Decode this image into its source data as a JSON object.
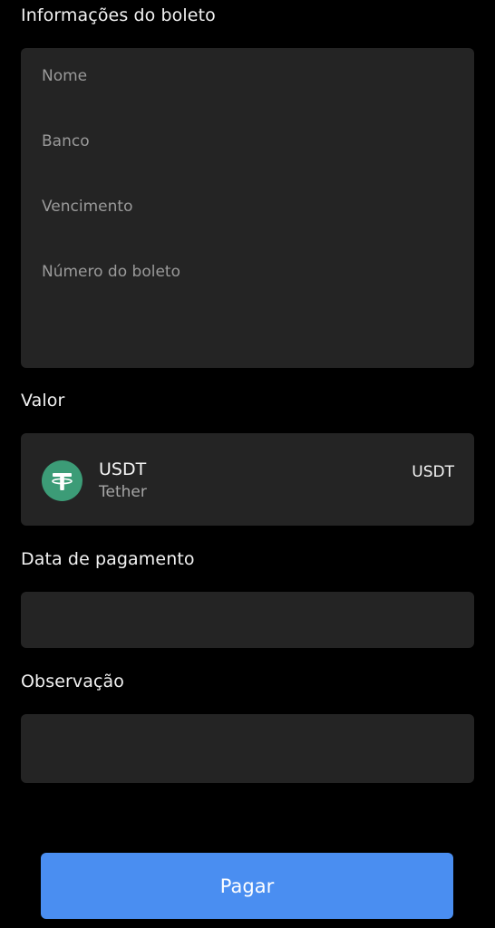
{
  "boleto_info": {
    "title": "Informações do boleto",
    "fields": [
      "Nome",
      "Banco",
      "Vencimento",
      "Número do boleto"
    ]
  },
  "valor": {
    "title": "Valor",
    "token_symbol": "USDT",
    "token_name": "Tether",
    "currency": "USDT",
    "icon": "tether-icon",
    "icon_color": "#3c9c77"
  },
  "data_pagamento": {
    "title": "Data de pagamento",
    "value": "",
    "placeholder": ""
  },
  "observacao": {
    "title": "Observação",
    "value": "",
    "placeholder": ""
  },
  "actions": {
    "pay_label": "Pagar",
    "pay_color": "#4a8ef1"
  }
}
